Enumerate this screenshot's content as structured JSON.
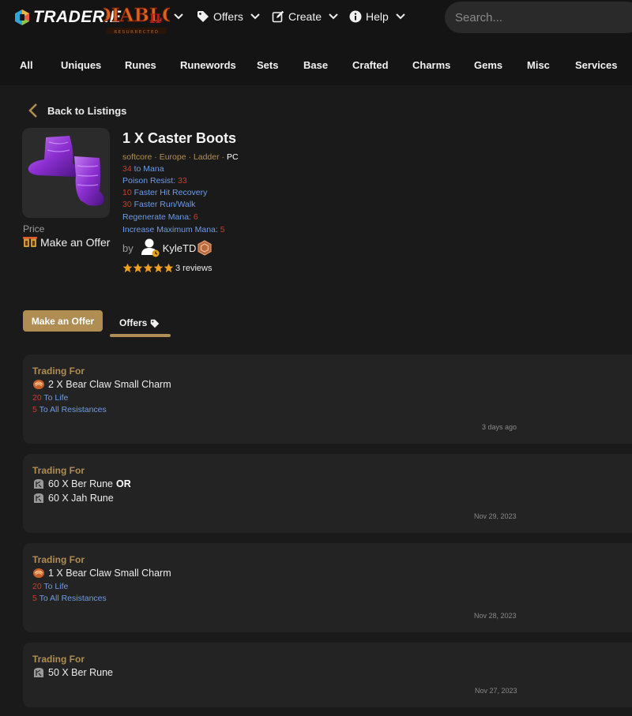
{
  "brand": {
    "name": "TRADERIE",
    "game": "Diablo II Resurrected"
  },
  "nav": {
    "offers": "Offers",
    "create": "Create",
    "help": "Help"
  },
  "search": {
    "placeholder": "Search..."
  },
  "categories": [
    "All",
    "Uniques",
    "Runes",
    "Runewords",
    "Sets",
    "Base",
    "Crafted",
    "Charms",
    "Gems",
    "Misc",
    "Services"
  ],
  "listing": {
    "back_label": "Back to Listings",
    "title": "1 X Caster Boots",
    "meta": {
      "mode": "softcore",
      "region": "Europe",
      "ladder": "Ladder",
      "platform": "PC",
      "sep": " · "
    },
    "stats": [
      {
        "value": "34",
        "label": " to Mana",
        "value_first": true
      },
      {
        "label": "Poison Resist: ",
        "value": "33",
        "value_first": false
      },
      {
        "value": "10",
        "label": " Faster Hit Recovery",
        "value_first": true
      },
      {
        "value": "30",
        "label": " Faster Run/Walk",
        "value_first": true
      },
      {
        "label": "Regenerate Mana: ",
        "value": "6",
        "value_first": false
      },
      {
        "label": "Increase Maximum Mana: ",
        "value": "5",
        "value_first": false
      }
    ],
    "price_label": "Price",
    "price_value": "Make an Offer",
    "by_label": "by",
    "seller": "KyleTD",
    "rating_stars": 5,
    "reviews": "3 reviews"
  },
  "actions": {
    "make_offer": "Make an Offer",
    "offers_tab": "Offers"
  },
  "offers": [
    {
      "heading": "Trading For",
      "items": [
        {
          "icon": "charm-icon",
          "text": "2 X Bear Claw Small Charm",
          "or": ""
        }
      ],
      "stats": [
        {
          "value": "20",
          "label": " To Life"
        },
        {
          "value": "5",
          "label": " To All Resistances"
        }
      ],
      "date": "3 days ago"
    },
    {
      "heading": "Trading For",
      "items": [
        {
          "icon": "rune-icon",
          "text": "60 X Ber Rune",
          "or": "OR"
        },
        {
          "icon": "rune-icon",
          "text": "60 X Jah Rune",
          "or": ""
        }
      ],
      "stats": [],
      "date": "Nov 29, 2023"
    },
    {
      "heading": "Trading For",
      "items": [
        {
          "icon": "charm-icon",
          "text": "1 X Bear Claw Small Charm",
          "or": ""
        }
      ],
      "stats": [
        {
          "value": "20",
          "label": " To Life"
        },
        {
          "value": "5",
          "label": " To All Resistances"
        }
      ],
      "date": "Nov 28, 2023"
    },
    {
      "heading": "Trading For",
      "items": [
        {
          "icon": "rune-icon",
          "text": "50 X Ber Rune",
          "or": ""
        }
      ],
      "stats": [],
      "date": "Nov 27, 2023"
    }
  ],
  "colors": {
    "accent": "#b08d52",
    "stat_blue": "#6f9ce3",
    "stat_red": "#d23a2e",
    "card_bg": "#232324"
  }
}
